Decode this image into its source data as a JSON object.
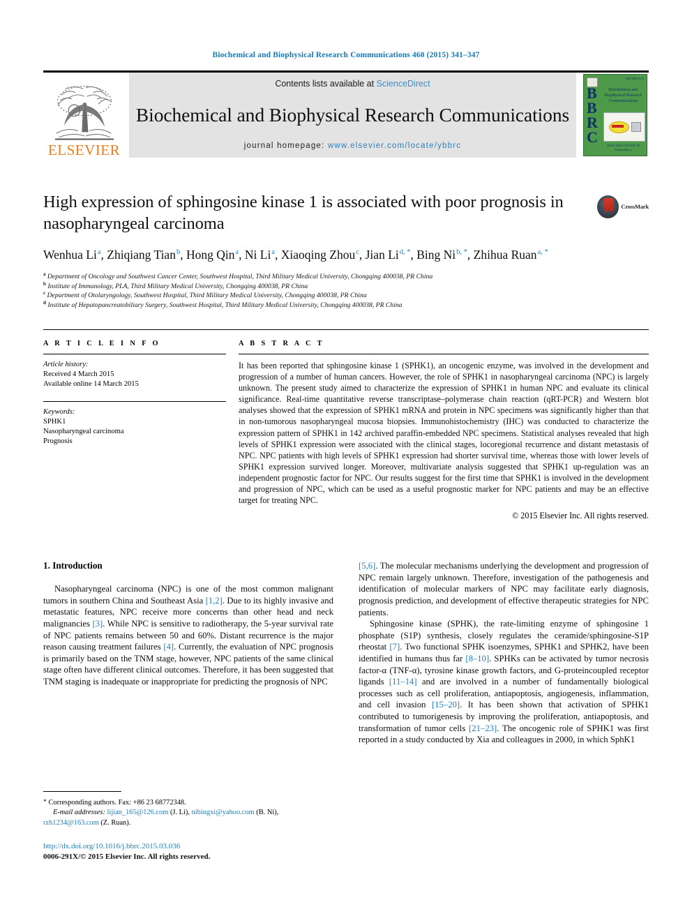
{
  "running_head": "Biochemical and Biophysical Research Communications 460 (2015) 341–347",
  "masthead": {
    "publisher": "ELSEVIER",
    "contents_prefix": "Contents lists available at ",
    "contents_link": "ScienceDirect",
    "journal_title": "Biochemical and Biophysical Research Communications",
    "homepage_prefix": "journal homepage: ",
    "homepage_url": "www.elsevier.com/locate/ybbrc",
    "cover": {
      "letters": "B\nB\nR\nC",
      "title": "Biochemical and Biophysical Research Communications",
      "footer": "AVAILABLE ONLINE AT\nScienceDirect",
      "corner": "ISSN 0006-291X"
    }
  },
  "article": {
    "title": "High expression of sphingosine kinase 1 is associated with poor prognosis in nasopharyngeal carcinoma",
    "crossmark_label": "CrossMark",
    "authors": [
      {
        "name": "Wenhua Li",
        "sup": "a",
        "sep": ", "
      },
      {
        "name": "Zhiqiang Tian",
        "sup": "b",
        "sep": ", "
      },
      {
        "name": "Hong Qin",
        "sup": "a",
        "sep": ", "
      },
      {
        "name": "Ni Li",
        "sup": "a",
        "sep": ", "
      },
      {
        "name": "Xiaoqing Zhou",
        "sup": "c",
        "sep": ", "
      },
      {
        "name": "Jian Li",
        "sup": "d, *",
        "sep": ", "
      },
      {
        "name": "Bing Ni",
        "sup": "b, *",
        "sep": ", "
      },
      {
        "name": "Zhihua Ruan",
        "sup": "a, *",
        "sep": ""
      }
    ],
    "affiliations": [
      {
        "key": "a",
        "text": "Department of Oncology and Southwest Cancer Center, Southwest Hospital, Third Military Medical University, Chongqing 400038, PR China"
      },
      {
        "key": "b",
        "text": "Institute of Immunology, PLA, Third Military Medical University, Chongqing 400038, PR China"
      },
      {
        "key": "c",
        "text": "Department of Otolaryngology, Southwest Hospital, Third Military Medical University, Chongqing 400038, PR China"
      },
      {
        "key": "d",
        "text": "Institute of Hepatopancreatobiliary Surgery, Southwest Hospital, Third Military Medical University, Chongqing 400038, PR China"
      }
    ]
  },
  "article_info": {
    "heading": "A R T I C L E   I N F O",
    "history_label": "Article history:",
    "history": [
      "Received 4 March 2015",
      "Available online 14 March 2015"
    ],
    "keywords_label": "Keywords:",
    "keywords": [
      "SPHK1",
      "Nasopharyngeal carcinoma",
      "Prognosis"
    ]
  },
  "abstract": {
    "heading": "A B S T R A C T",
    "text": "It has been reported that sphingosine kinase 1 (SPHK1), an oncogenic enzyme, was involved in the development and progression of a number of human cancers. However, the role of SPHK1 in nasopharyngeal carcinoma (NPC) is largely unknown. The present study aimed to characterize the expression of SPHK1 in human NPC and evaluate its clinical significance. Real-time quantitative reverse transcriptase–polymerase chain reaction (qRT-PCR) and Western blot analyses showed that the expression of SPHK1 mRNA and protein in NPC specimens was significantly higher than that in non-tumorous nasopharyngeal mucosa biopsies. Immunohistochemistry (IHC) was conducted to characterize the expression pattern of SPHK1 in 142 archived paraffin-embedded NPC specimens. Statistical analyses revealed that high levels of SPHK1 expression were associated with the clinical stages, locoregional recurrence and distant metastasis of NPC. NPC patients with high levels of SPHK1 expression had shorter survival time, whereas those with lower levels of SPHK1 expression survived longer. Moreover, multivariate analysis suggested that SPHK1 up-regulation was an independent prognostic factor for NPC. Our results suggest for the first time that SPHK1 is involved in the development and progression of NPC, which can be used as a useful prognostic marker for NPC patients and may be an effective target for treating NPC.",
    "copyright": "© 2015 Elsevier Inc. All rights reserved."
  },
  "body": {
    "section_title": "1. Introduction",
    "left_paragraph_1_a": "Nasopharyngeal carcinoma (NPC) is one of the most common malignant tumors in southern China and Southeast Asia ",
    "left_ref_1": "[1,2]",
    "left_paragraph_1_b": ". Due to its highly invasive and metastatic features, NPC receive more concerns than other head and neck malignancies ",
    "left_ref_2": "[3]",
    "left_paragraph_1_c": ". While NPC is sensitive to radiotherapy, the 5-year survival rate of NPC patients remains between 50 and 60%. Distant recurrence is the major reason causing treatment failures ",
    "left_ref_3": "[4]",
    "left_paragraph_1_d": ". Currently, the evaluation of NPC prognosis is primarily based on the TNM stage, however, NPC patients of the same clinical stage often have different clinical outcomes. Therefore, it has been suggested that TNM staging is inadequate or inappropriate for predicting the prognosis of NPC",
    "right_ref_1": "[5,6]",
    "right_paragraph_1": ". The molecular mechanisms underlying the development and progression of NPC remain largely unknown. Therefore, investigation of the pathogenesis and identification of molecular markers of NPC may facilitate early diagnosis, prognosis prediction, and development of effective therapeutic strategies for NPC patients.",
    "right_paragraph_2_a": "Sphingosine kinase (SPHK), the rate-limiting enzyme of sphingosine 1 phosphate (S1P) synthesis, closely regulates the ceramide/sphingosine-S1P rheostat ",
    "right_ref_2": "[7]",
    "right_paragraph_2_b": ". Two functional SPHK isoenzymes, SPHK1 and SPHK2, have been identified in humans thus far ",
    "right_ref_3": "[8–10]",
    "right_paragraph_2_c": ". SPHKs can be activated by tumor necrosis factor-α (TNF-α), tyrosine kinase growth factors, and G-proteincoupled receptor ligands ",
    "right_ref_4": "[11–14]",
    "right_paragraph_2_d": " and are involved in a number of fundamentally biological processes such as cell proliferation, antiapoptosis, angiogenesis, inflammation, and cell invasion ",
    "right_ref_5": "[15–20]",
    "right_paragraph_2_e": ". It has been shown that activation of SPHK1 contributed to tumorigenesis by improving the proliferation, antiapoptosis, and transformation of tumor cells ",
    "right_ref_6": "[21–23]",
    "right_paragraph_2_f": ". The oncogenic role of SPHK1 was first reported in a study conducted by Xia and colleagues in 2000, in which SphK1"
  },
  "footnotes": {
    "corresponding_star": "*",
    "corresponding": "Corresponding authors. Fax: +86 23 68772348.",
    "email_label": "E-mail addresses:",
    "email_1": "lijian_165@126.com",
    "email_1_owner": "(J. Li)",
    "email_2": "nibingxi@yahoo.com",
    "email_2_owner": "(B. Ni)",
    "email_3": "rzh1234@163.com",
    "email_3_owner": "(Z. Ruan)",
    "doi": "http://dx.doi.org/10.1016/j.bbrc.2015.03.036",
    "issn_line": "0006-291X/© 2015 Elsevier Inc. All rights reserved."
  },
  "colors": {
    "link": "#1d7fbf",
    "running_head": "#1679b5",
    "elsevier_orange": "#f07d1a",
    "cover_green": "#4c9a4a"
  }
}
